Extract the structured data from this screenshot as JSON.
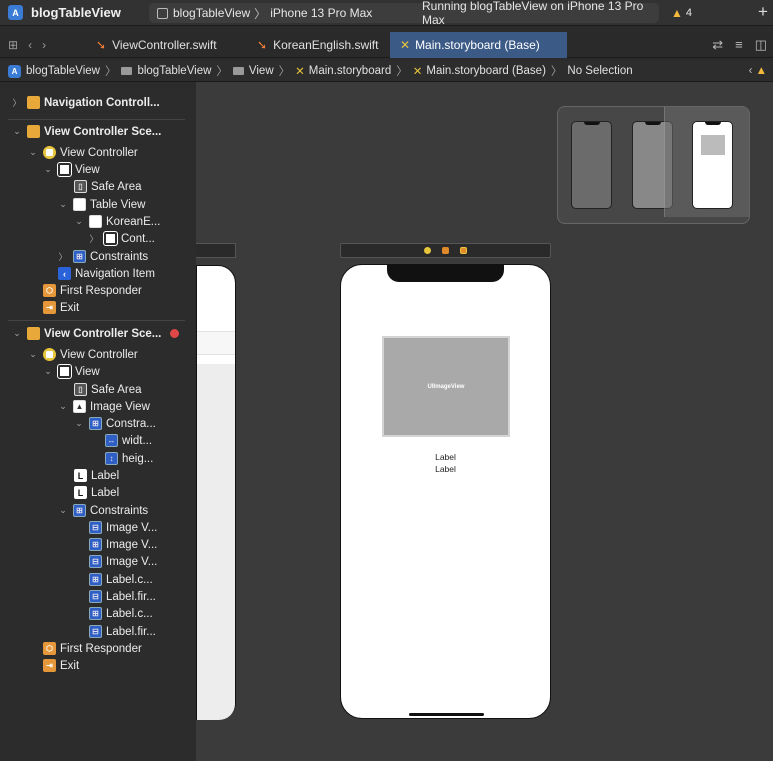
{
  "titlebar": {
    "app_title": "blogTableView",
    "scheme_target": "blogTableView",
    "scheme_separator": "〉",
    "scheme_device": "iPhone 13 Pro Max",
    "status": "Running blogTableView on iPhone 13 Pro Max",
    "warning_count": "4",
    "add_symbol": "+"
  },
  "tabs": [
    {
      "label": "ViewController.swift"
    },
    {
      "label": "KoreanEnglish.swift"
    },
    {
      "label": "Main.storyboard (Base)"
    }
  ],
  "jumpbar": {
    "items": [
      "blogTableView",
      "blogTableView",
      "View",
      "Main.storyboard",
      "Main.storyboard (Base)",
      "No Selection"
    ]
  },
  "outline": {
    "scene1": {
      "title": "Navigation Controll...",
      "vc_scene": "View Controller Sce...",
      "vc": "View Controller",
      "view": "View",
      "safe_area": "Safe Area",
      "table_view": "Table View",
      "cell": "KoreanE...",
      "content": "Cont...",
      "constraints": "Constraints",
      "nav_item": "Navigation Item",
      "first_responder": "First Responder",
      "exit": "Exit"
    },
    "scene2": {
      "vc_scene": "View Controller Sce...",
      "vc": "View Controller",
      "view": "View",
      "safe_area": "Safe Area",
      "image_view": "Image View",
      "constraints_inner": "Constra...",
      "width": "widt...",
      "height": "heig...",
      "label1": "Label",
      "label2": "Label",
      "constraints": "Constraints",
      "c1": "Image V...",
      "c2": "Image V...",
      "c3": "Image V...",
      "c4": "Label.c...",
      "c5": "Label.fir...",
      "c6": "Label.c...",
      "c7": "Label.fir...",
      "first_responder": "First Responder",
      "exit": "Exit"
    }
  },
  "canvas": {
    "image_view_text": "UIImageView",
    "label1": "Label",
    "label2": "Label"
  },
  "colors": {
    "accent": "#3b5a86",
    "warning": "#f2b93b",
    "error": "#e04848",
    "scene_icon": "#e8a93a"
  }
}
